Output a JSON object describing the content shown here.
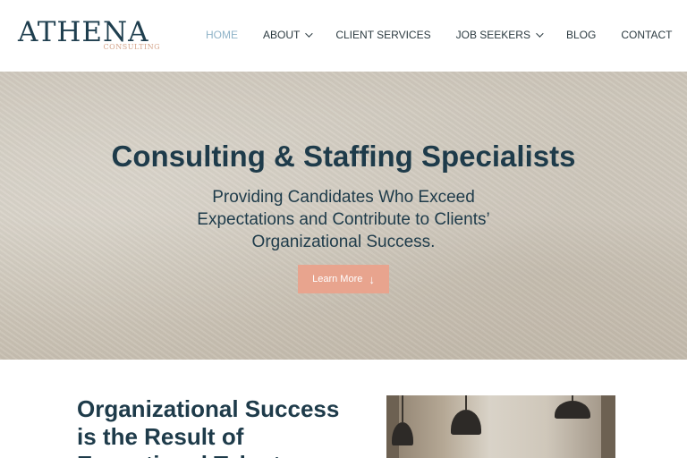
{
  "brand": {
    "name": "ATHENA",
    "tagline": "CONSULTING"
  },
  "nav": {
    "items": [
      {
        "label": "HOME",
        "active": true,
        "dropdown": false
      },
      {
        "label": "ABOUT",
        "active": false,
        "dropdown": true
      },
      {
        "label": "CLIENT SERVICES",
        "active": false,
        "dropdown": false
      },
      {
        "label": "JOB SEEKERS",
        "active": false,
        "dropdown": true
      },
      {
        "label": "BLOG",
        "active": false,
        "dropdown": false
      },
      {
        "label": "CONTACT",
        "active": false,
        "dropdown": false
      }
    ]
  },
  "hero": {
    "title": "Consulting & Staffing Specialists",
    "subtitle": "Providing Candidates Who Exceed Expectations and Contribute to Clients’ Organizational Success.",
    "button_label": "Learn More",
    "button_icon": "arrow-down-icon"
  },
  "section": {
    "heading": "Organizational Success is the Result of Exceptional Talent"
  },
  "colors": {
    "accent": "#e8a48e",
    "nav_active": "#8fb3c8",
    "heading": "#1e3b4a",
    "logo_sub": "#d4a48a"
  }
}
